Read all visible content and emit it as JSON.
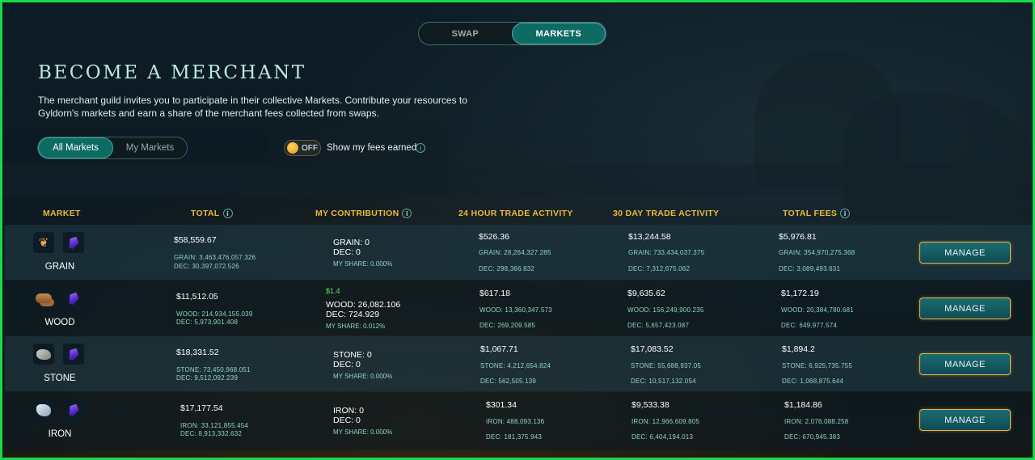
{
  "tabs": {
    "swap": "SWAP",
    "markets": "MARKETS"
  },
  "title": "BECOME A MERCHANT",
  "intro": "The merchant guild invites you to participate in their collective Markets. Contribute your resources to Gyldorn's markets and earn a share of the merchant fees collected from swaps.",
  "filters": {
    "all": "All Markets",
    "mine": "My Markets"
  },
  "fee_toggle": {
    "state": "OFF",
    "label": "Show my fees earned"
  },
  "columns": {
    "market": "MARKET",
    "total": "TOTAL",
    "contribution": "MY CONTRIBUTION",
    "h24": "24 HOUR TRADE ACTIVITY",
    "d30": "30 DAY TRADE ACTIVITY",
    "fees": "TOTAL FEES"
  },
  "manage_label": "MANAGE",
  "rows": [
    {
      "name": "GRAIN",
      "icon": "wheat-icon",
      "total": "$58,559.67",
      "total_res": "GRAIN: 3,463,476,057.326",
      "total_dec": "DEC: 30,397,072.526",
      "contrib_usd": "",
      "contrib_res": "GRAIN:   0",
      "contrib_dec": "DEC:   0",
      "share": "MY SHARE: 0.000%",
      "h24": "$526.36",
      "h24_res": "GRAIN: 28,264,327.285",
      "h24_dec": "DEC: 298,366.832",
      "d30": "$13,244.58",
      "d30_res": "GRAIN: 733,434,037.375",
      "d30_dec": "DEC: 7,312,675.062",
      "fees": "$5,976.81",
      "fees_res": "GRAIN: 354,970,275.368",
      "fees_dec": "DEC: 3,089,493.631"
    },
    {
      "name": "WOOD",
      "icon": "wood-icon",
      "total": "$11,512.05",
      "total_res": "WOOD: 214,934,155.039",
      "total_dec": "DEC: 5,973,901.408",
      "contrib_usd": "$1.4",
      "contrib_res": "WOOD:   26,082.106",
      "contrib_dec": "DEC:   724.929",
      "share": "MY SHARE: 0.012%",
      "h24": "$617.18",
      "h24_res": "WOOD: 13,360,347.573",
      "h24_dec": "DEC: 269,209.585",
      "d30": "$9,635.62",
      "d30_res": "WOOD: 156,249,900.235",
      "d30_dec": "DEC: 5,657,423.087",
      "fees": "$1,172.19",
      "fees_res": "WOOD: 20,384,780.681",
      "fees_dec": "DEC: 649,977.574"
    },
    {
      "name": "STONE",
      "icon": "stone-icon",
      "total": "$18,331.52",
      "total_res": "STONE: 73,450,968.051",
      "total_dec": "DEC: 9,512,092.239",
      "contrib_usd": "",
      "contrib_res": "STONE:   0",
      "contrib_dec": "DEC:   0",
      "share": "MY SHARE: 0.000%",
      "h24": "$1,067.71",
      "h24_res": "STONE: 4,212,654.824",
      "h24_dec": "DEC: 562,505.139",
      "d30": "$17,083.52",
      "d30_res": "STONE: 55,688,937.05",
      "d30_dec": "DEC: 10,517,132.054",
      "fees": "$1,894.2",
      "fees_res": "STONE: 6,925,735.755",
      "fees_dec": "DEC: 1,068,875.644"
    },
    {
      "name": "IRON",
      "icon": "iron-icon",
      "total": "$17,177.54",
      "total_res": "IRON: 33,121,855.454",
      "total_dec": "DEC: 8,913,332.632",
      "contrib_usd": "",
      "contrib_res": "IRON:   0",
      "contrib_dec": "DEC:   0",
      "share": "MY SHARE: 0.000%",
      "h24": "$301.34",
      "h24_res": "IRON: 488,093.136",
      "h24_dec": "DEC: 181,375.943",
      "d30": "$9,533.38",
      "d30_res": "IRON: 12,966,609.805",
      "d30_dec": "DEC: 6,404,194.013",
      "fees": "$1,184.86",
      "fees_res": "IRON: 2,076,088.258",
      "fees_dec": "DEC: 670,945.383"
    }
  ],
  "colors": {
    "accent": "#0d6b63",
    "gold": "#e9b93a",
    "frame": "#19d84a"
  }
}
